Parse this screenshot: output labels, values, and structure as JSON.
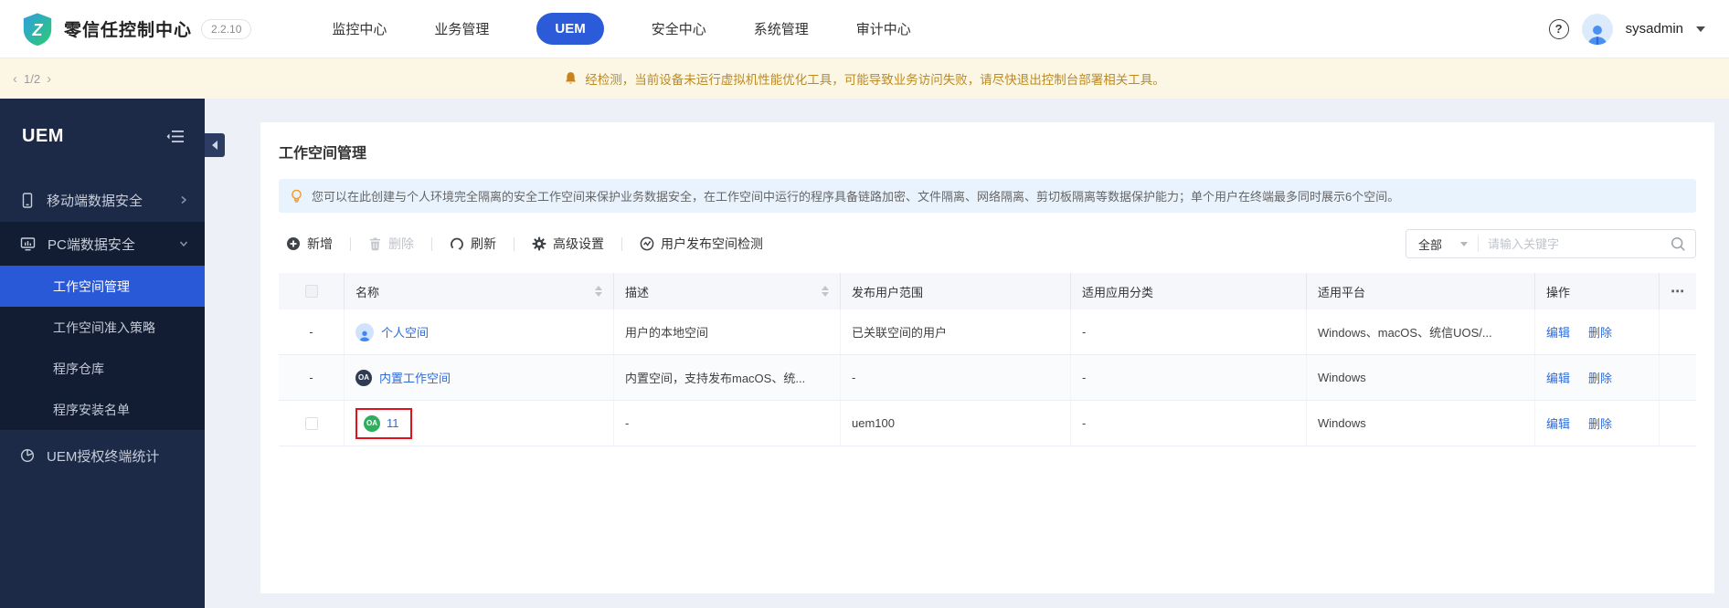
{
  "header": {
    "logo_glyph": "Z",
    "title": "零信任控制中心",
    "version": "2.2.10",
    "help_glyph": "?",
    "nav": [
      {
        "label": "监控中心",
        "active": false
      },
      {
        "label": "业务管理",
        "active": false
      },
      {
        "label": "UEM",
        "active": true
      },
      {
        "label": "安全中心",
        "active": false
      },
      {
        "label": "系统管理",
        "active": false
      },
      {
        "label": "审计中心",
        "active": false
      }
    ],
    "user": {
      "name": "sysadmin"
    }
  },
  "notice": {
    "prev_glyph": "‹",
    "page_indicator": "1/2",
    "next_glyph": "›",
    "message": "经检测，当前设备未运行虚拟机性能优化工具，可能导致业务访问失败，请尽快退出控制台部署相关工具。"
  },
  "sidebar": {
    "title": "UEM",
    "items": [
      {
        "label": "移动端数据安全"
      },
      {
        "label": "PC端数据安全"
      },
      {
        "label": "UEM授权终端统计"
      }
    ],
    "pc_children": [
      {
        "label": "工作空间管理",
        "active": true
      },
      {
        "label": "工作空间准入策略",
        "active": false
      },
      {
        "label": "程序仓库",
        "active": false
      },
      {
        "label": "程序安装名单",
        "active": false
      }
    ]
  },
  "main": {
    "page_title": "工作空间管理",
    "info_text": "您可以在此创建与个人环境完全隔离的安全工作空间来保护业务数据安全，在工作空间中运行的程序具备链路加密、文件隔离、网络隔离、剪切板隔离等数据保护能力；单个用户在终端最多同时展示6个空间。",
    "toolbar": {
      "add": "新增",
      "delete": "删除",
      "refresh": "刷新",
      "advanced": "高级设置",
      "detect": "用户发布空间检测"
    },
    "filter": {
      "value": "全部"
    },
    "search": {
      "placeholder": "请输入关键字"
    },
    "table": {
      "more_glyph": "⋯",
      "columns": [
        "名称",
        "描述",
        "发布用户范围",
        "适用应用分类",
        "适用平台",
        "操作"
      ],
      "rows": [
        {
          "select": "-",
          "name": "个人空间",
          "desc": "用户的本地空间",
          "scope": "已关联空间的用户",
          "category": "-",
          "platform": "Windows、macOS、统信UOS/...",
          "edit": "编辑",
          "del": "删除"
        },
        {
          "select": "-",
          "badge": "OA",
          "name": "内置工作空间",
          "desc": "内置空间，支持发布macOS、统...",
          "scope": "-",
          "category": "-",
          "platform": "Windows",
          "edit": "编辑",
          "del": "删除"
        },
        {
          "badge": "OA",
          "name": "11",
          "desc": "-",
          "scope": "uem100",
          "category": "-",
          "platform": "Windows",
          "edit": "编辑",
          "del": "删除"
        }
      ]
    }
  },
  "colors": {
    "accent_blue": "#2b5bd9",
    "link_blue": "#2f6bd8",
    "sidebar_bg": "#1c2a48",
    "sidebar_section_bg": "#121d33",
    "sidebar_active": "#2a59d8",
    "warning_bg": "#fcf6e5",
    "warning_text": "#bd8a1f",
    "info_bg": "#e9f3fd",
    "highlight_red": "#e3111b",
    "oa_dark": "#2e3b52",
    "oa_green": "#2fae5d"
  }
}
